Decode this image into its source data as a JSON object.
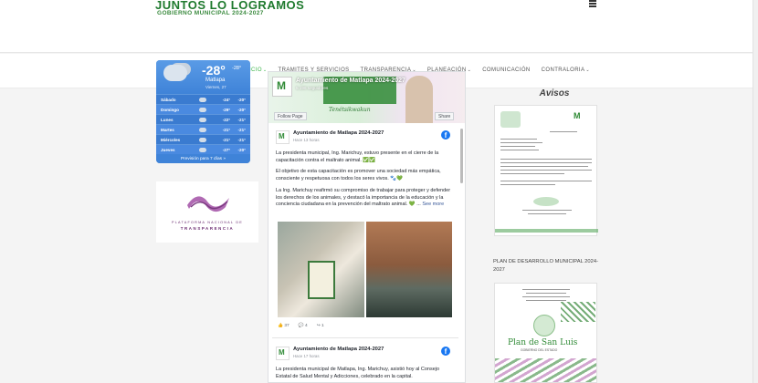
{
  "header": {
    "logo_line1": "JUNTOS LO LOGRAMOS",
    "logo_line2": "GOBIERNO MUNICIPAL 2024-2027"
  },
  "nav": {
    "items": [
      {
        "label": "INICIO",
        "caret": "⌄",
        "active": true
      },
      {
        "label": "TRAMITES Y SERVICIOS",
        "caret": "",
        "active": false
      },
      {
        "label": "TRANSPARENCIA",
        "caret": "⌄",
        "active": false
      },
      {
        "label": "PLANEACIÓN",
        "caret": "⌄",
        "active": false
      },
      {
        "label": "COMUNICACIÓN",
        "caret": "",
        "active": false
      },
      {
        "label": "CONTRALORIA",
        "caret": "⌄",
        "active": false
      }
    ]
  },
  "weather": {
    "temp": "-28°",
    "feels": "-28°",
    "city": "Matlapa",
    "date": "Viernes, 27",
    "days": [
      {
        "day": "Sábado",
        "hi": "-24°",
        "lo": "-20°"
      },
      {
        "day": "Domingo",
        "hi": "-29°",
        "lo": "-20°"
      },
      {
        "day": "Lunes",
        "hi": "-22°",
        "lo": "-21°"
      },
      {
        "day": "Martes",
        "hi": "-21°",
        "lo": "-21°"
      },
      {
        "day": "Miércoles",
        "hi": "-21°",
        "lo": "-21°"
      },
      {
        "day": "Jueves",
        "hi": "-27°",
        "lo": "-20°"
      }
    ],
    "more": "Previsión para 7 días »"
  },
  "transparency": {
    "line1": "PLATAFORMA NACIONAL DE",
    "line2": "TRANSPARENCIA"
  },
  "facebook": {
    "page_name": "Ayuntamiento de Matlapa 2024-2027",
    "followers": "5.196 seguidores",
    "cover_signature": "Tenétsikwakun",
    "follow_label": "Follow Page",
    "share_label": "Share",
    "posts": [
      {
        "name": "Ayuntamiento de Matlapa 2024-2027",
        "time": "Hace 13 horas",
        "p1": "La presidenta municipal, Ing. Marichuy, estuvo presente en el cierre de la capacitación contra el maltrato animal. ✅✅",
        "p2": "El objetivo de esta capacitación es promover una sociedad más empática, consciente y respetuosa con todos los seres vivos. 🐾💚",
        "p3": "La Ing. Marichuy reafirmó su compromiso de trabajar para proteger y defender los derechos de los animales, y destacó la importancia de la educación y la conciencia ciudadana en la prevención del maltrato animal. 💚 ...",
        "see_more": "See more",
        "likes": "37",
        "comments": "4",
        "shares": "1"
      },
      {
        "name": "Ayuntamiento de Matlapa 2024-2027",
        "time": "Hace 17 horas",
        "p1": "La presidenta municipal de Matlapa, Ing. Marichuy, asistió hoy al Consejo Estatal de Salud Mental y Adicciones, celebrado en la capital."
      }
    ]
  },
  "sidebar": {
    "avisos_title": "Avisos",
    "plan_title": "PLAN DE DESARROLLO MUNICIPAL 2024-2027",
    "plan_logo": "Plan de San Luis",
    "plan_sub": "GOBIERNO DEL ESTADO"
  },
  "colors": {
    "accent_green": "#3bb54a",
    "weather_blue": "#3f83d8",
    "facebook_blue": "#1877f2"
  }
}
